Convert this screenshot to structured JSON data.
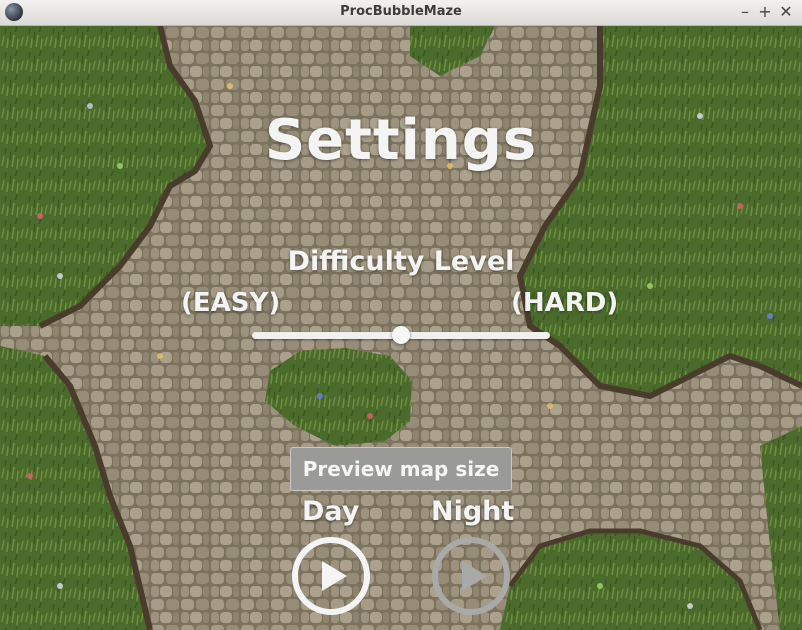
{
  "window": {
    "title": "ProcBubbleMaze",
    "controls": {
      "minimize": "–",
      "maximize": "+",
      "close": "✕"
    }
  },
  "screen": {
    "title": "Settings",
    "difficulty": {
      "label": "Difficulty Level",
      "min_label": "(EASY)",
      "max_label": "(HARD)",
      "value": 0.5
    },
    "preview_button": "Preview map size",
    "modes": [
      {
        "label": "Day",
        "icon": "play-icon",
        "selected": true
      },
      {
        "label": "Night",
        "icon": "play-icon",
        "selected": false
      }
    ]
  },
  "colors": {
    "text": "#f4f4f4",
    "grass": "#4b6b2c",
    "stone": "#9b917d",
    "button": "#9a9a98",
    "day_icon": "#f4f4f4",
    "night_icon": "#a9a9a7"
  }
}
